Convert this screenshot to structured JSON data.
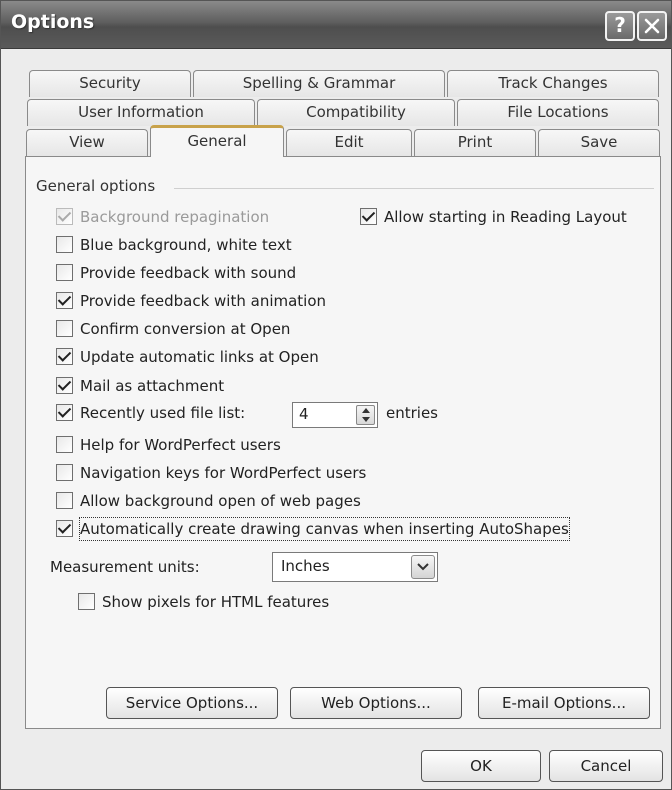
{
  "window": {
    "title": "Options",
    "help_glyph": "?"
  },
  "tabs": {
    "row1": [
      "Security",
      "Spelling & Grammar",
      "Track Changes"
    ],
    "row2": [
      "User Information",
      "Compatibility",
      "File Locations"
    ],
    "row3": [
      "View",
      "General",
      "Edit",
      "Print",
      "Save"
    ],
    "active": "General"
  },
  "general": {
    "group_label": "General options",
    "options": [
      {
        "label": "Background repagination",
        "checked": true,
        "disabled": true
      },
      {
        "label": "Allow starting in Reading Layout",
        "checked": true
      },
      {
        "label": "Blue background, white text",
        "checked": false
      },
      {
        "label": "Provide feedback with sound",
        "checked": false
      },
      {
        "label": "Provide feedback with animation",
        "checked": true
      },
      {
        "label": "Confirm conversion at Open",
        "checked": false
      },
      {
        "label": "Update automatic links at Open",
        "checked": true
      },
      {
        "label": "Mail as attachment",
        "checked": true
      },
      {
        "label": "Recently used file list:",
        "checked": true
      },
      {
        "label": "Help for WordPerfect users",
        "checked": false
      },
      {
        "label": "Navigation keys for WordPerfect users",
        "checked": false
      },
      {
        "label": "Allow background open of web pages",
        "checked": false
      },
      {
        "label": "Automatically create drawing canvas when inserting AutoShapes",
        "checked": true
      },
      {
        "label": "Show pixels for HTML features",
        "checked": false
      }
    ],
    "recent_files_count": "4",
    "entries_label": "entries",
    "measurement_label": "Measurement units:",
    "measurement_value": "Inches"
  },
  "buttons": {
    "service": "Service Options...",
    "web": "Web Options...",
    "email": "E-mail Options...",
    "ok": "OK",
    "cancel": "Cancel"
  }
}
